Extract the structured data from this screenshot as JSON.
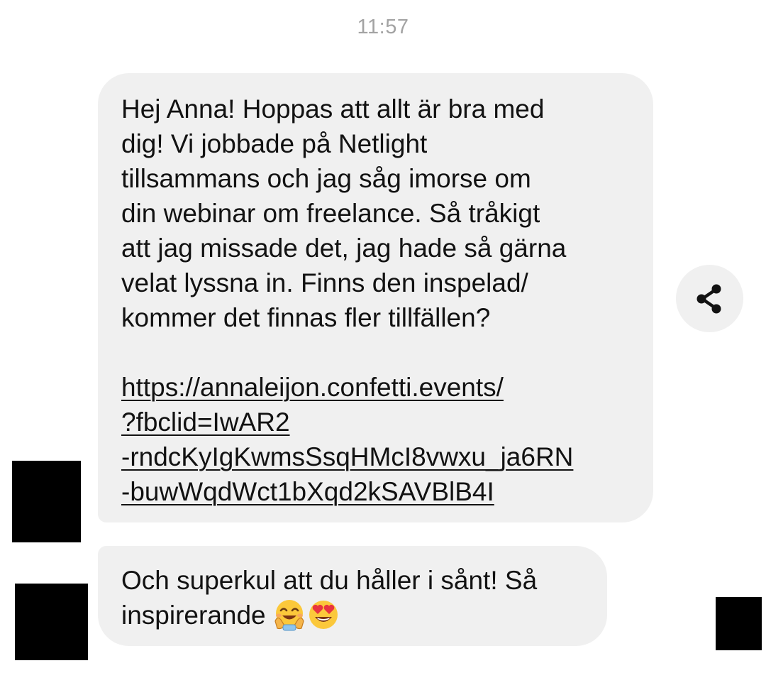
{
  "timestamp": "11:57",
  "messages": [
    {
      "lines": [
        "Hej Anna! Hoppas att allt är bra med",
        "dig! Vi jobbade på Netlight",
        "tillsammans och jag såg imorse om",
        "din webinar om freelance. Så tråkigt",
        "att jag missade det, jag hade så gärna",
        "velat lyssna in. Finns den inspelad/",
        "kommer det finnas fler tillfällen?"
      ],
      "link_lines": [
        "https://annaleijon.confetti.events/",
        "?fbclid=IwAR2",
        "-rndcKyIgKwmsSsqHMcI8vwxu_ja6RN",
        "-buwWqdWct1bXqd2kSAVBlB4I"
      ]
    },
    {
      "lines": [
        "Och superkul att du håller i sånt! Så",
        "inspirerande"
      ],
      "emojis": [
        "smiling-face-with-open-hands-emoji",
        "heart-eyes-emoji"
      ]
    }
  ],
  "share_button": {
    "icon": "share-icon"
  },
  "colors": {
    "bubble": "#f0f0f0",
    "text": "#121212",
    "timestamp": "#a3a3a3",
    "redaction": "#000000"
  }
}
